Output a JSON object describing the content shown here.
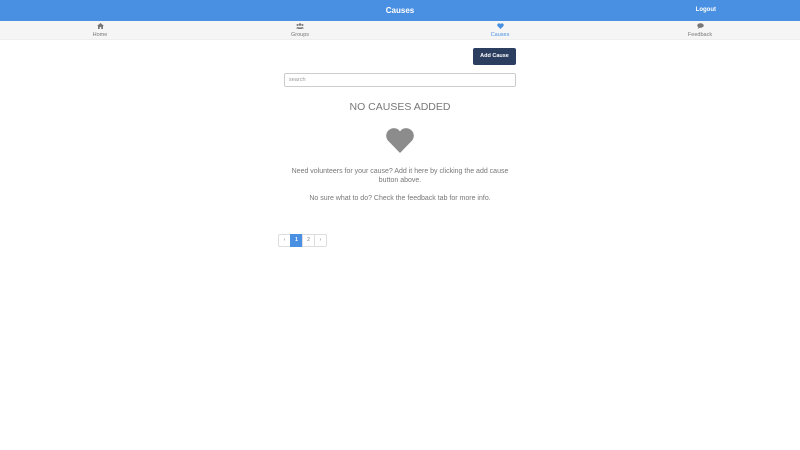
{
  "header": {
    "title": "Causes",
    "logout_label": "Logout"
  },
  "tabs": [
    {
      "label": "Home",
      "icon": "home-icon",
      "active": false
    },
    {
      "label": "Groups",
      "icon": "users-icon",
      "active": false
    },
    {
      "label": "Causes",
      "icon": "heart-icon",
      "active": true
    },
    {
      "label": "Feedback",
      "icon": "comment-icon",
      "active": false
    }
  ],
  "toolbar": {
    "add_cause_label": "Add Cause"
  },
  "search": {
    "placeholder": "search",
    "value": ""
  },
  "empty_state": {
    "title": "NO CAUSES ADDED",
    "icon": "heart-icon",
    "message": "Need volunteers for your cause? Add it here by clicking the add cause button above.",
    "help": "No sure what to do? Check the feedback tab for more info."
  },
  "pagination": {
    "prev": "‹",
    "pages": [
      "1",
      "2"
    ],
    "current": "1",
    "next": "›"
  },
  "colors": {
    "header_bg": "#4a90e2",
    "accent": "#4a90e2",
    "button_bg": "#2c3e60",
    "muted_text": "#777777"
  }
}
